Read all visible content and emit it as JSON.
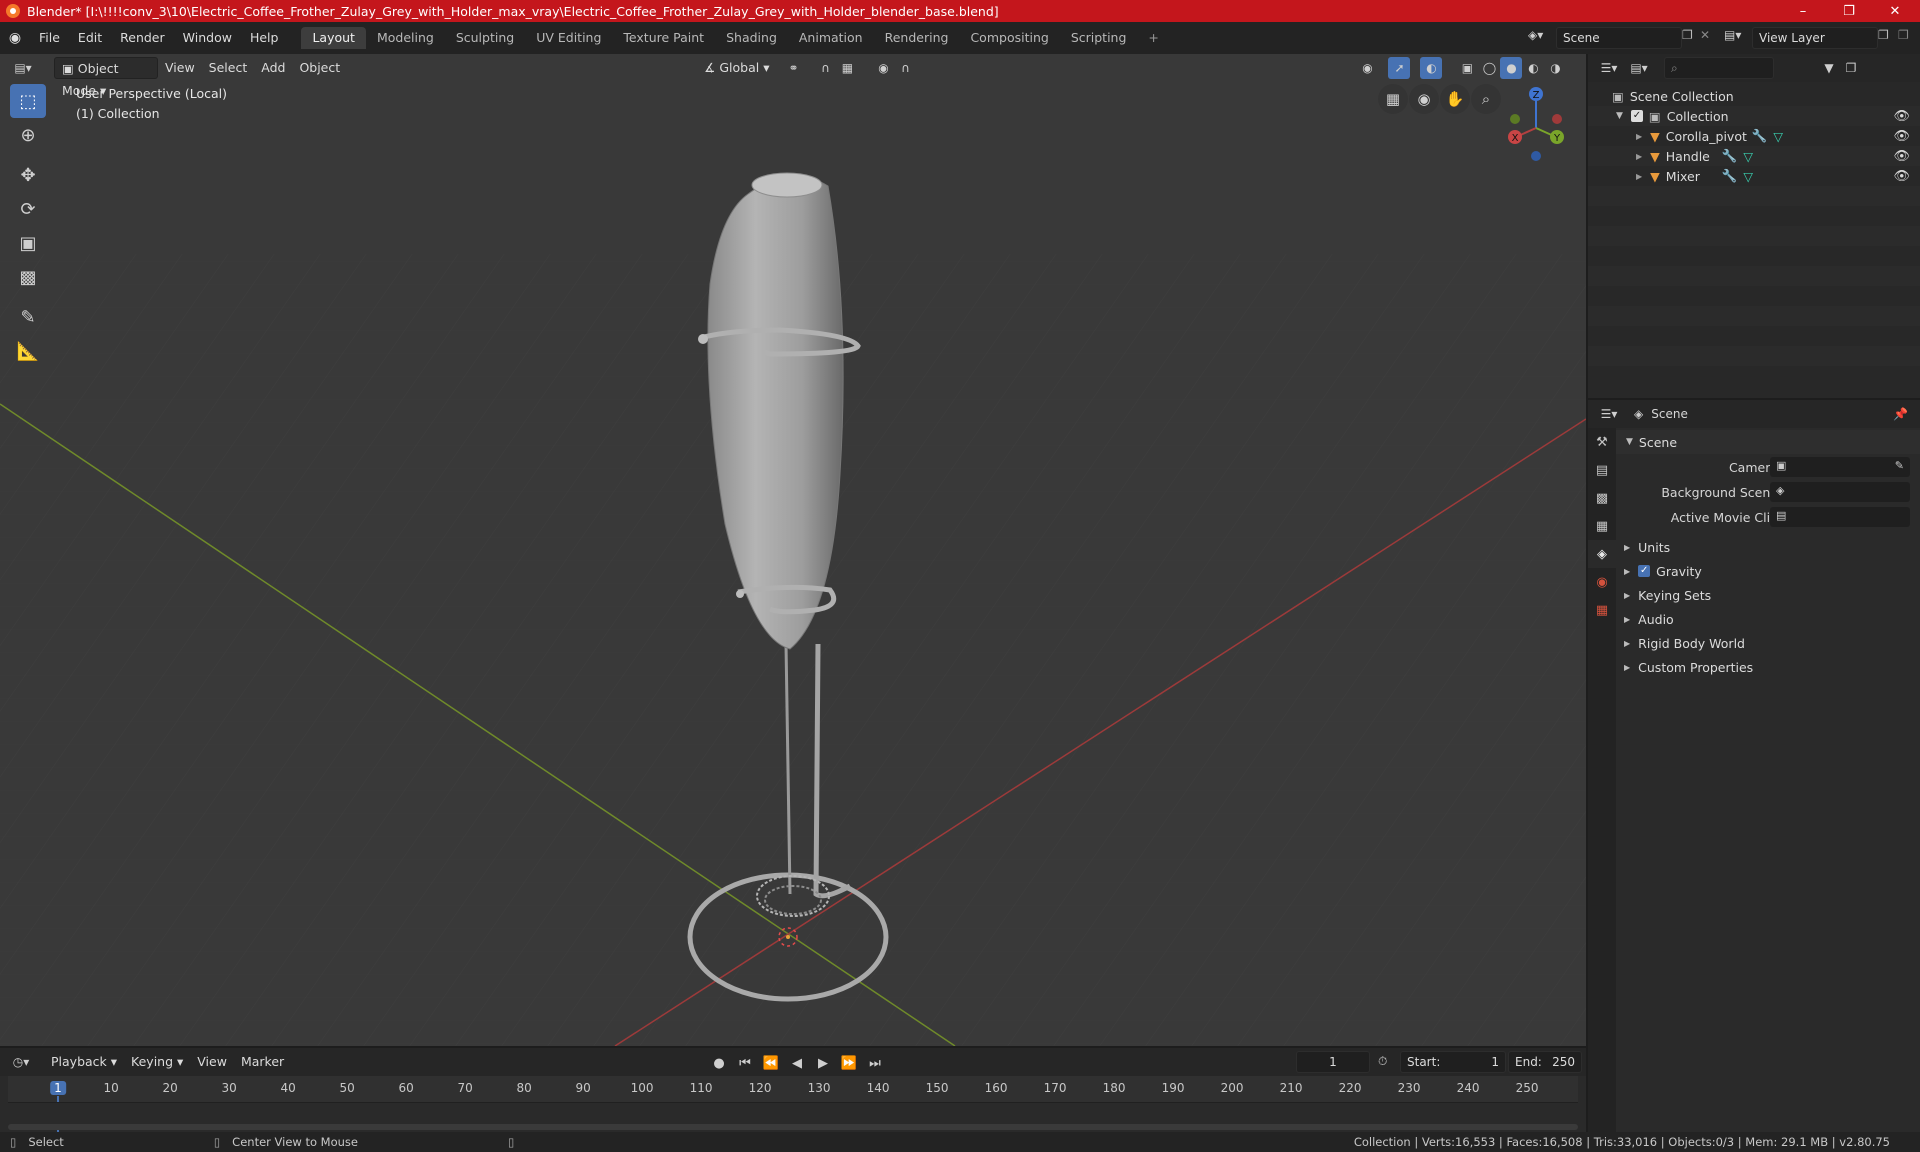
{
  "titlebar": {
    "title": "Blender* [I:\\!!!!conv_3\\10\\Electric_Coffee_Frother_Zulay_Grey_with_Holder_max_vray\\Electric_Coffee_Frother_Zulay_Grey_with_Holder_blender_base.blend]"
  },
  "menu": {
    "file": "File",
    "edit": "Edit",
    "render": "Render",
    "window": "Window",
    "help": "Help"
  },
  "workspaces": [
    "Layout",
    "Modeling",
    "Sculpting",
    "UV Editing",
    "Texture Paint",
    "Shading",
    "Animation",
    "Rendering",
    "Compositing",
    "Scripting"
  ],
  "scene_field": "Scene",
  "view_layer_field": "View Layer",
  "viewport": {
    "mode": "Object Mode",
    "view": "View",
    "select": "Select",
    "add": "Add",
    "object": "Object",
    "orientation": "Global",
    "info_line1": "User Perspective (Local)",
    "info_line2": "(1) Collection",
    "gizmo": {
      "z": "Z",
      "y": "Y",
      "x": "X"
    }
  },
  "outliner": {
    "scene_collection": "Scene Collection",
    "collection": "Collection",
    "objects": [
      "Corolla_pivot",
      "Handle",
      "Mixer"
    ]
  },
  "properties": {
    "header": "Scene",
    "panel_scene": "Scene",
    "camera_label": "Camera",
    "background_scene_label": "Background Scene",
    "active_movie_clip_label": "Active Movie Clip",
    "sections": [
      "Units",
      "Gravity",
      "Keying Sets",
      "Audio",
      "Rigid Body World",
      "Custom Properties"
    ]
  },
  "timeline": {
    "playback": "Playback",
    "keying": "Keying",
    "view": "View",
    "marker": "Marker",
    "current_frame": "1",
    "start_label": "Start:",
    "start_value": "1",
    "end_label": "End:",
    "end_value": "250",
    "ticks": [
      "1",
      "10",
      "20",
      "30",
      "40",
      "50",
      "60",
      "70",
      "80",
      "90",
      "100",
      "110",
      "120",
      "130",
      "140",
      "150",
      "160",
      "170",
      "180",
      "190",
      "200",
      "210",
      "220",
      "230",
      "240",
      "250"
    ]
  },
  "statusbar": {
    "select": "Select",
    "center_view": "Center View to Mouse",
    "stats": "Collection | Verts:16,553 | Faces:16,508 | Tris:33,016 | Objects:0/3 | Mem: 29.1 MB | v2.80.75"
  },
  "colors": {
    "accent": "#4772b3",
    "titlebar": "#c4161c",
    "x_axis": "#b34040",
    "y_axis": "#7aa52a",
    "z_axis": "#3f74d1"
  }
}
